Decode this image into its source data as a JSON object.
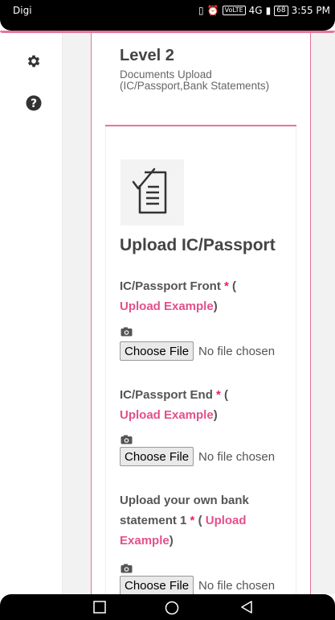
{
  "status_bar": {
    "carrier": "Digi",
    "network": "4G",
    "volte": "VoLTE",
    "battery": "68",
    "time": "3:55 PM"
  },
  "sidebar": {
    "items": [
      {
        "icon": "gear-icon"
      },
      {
        "icon": "help-icon"
      }
    ]
  },
  "level": {
    "title": "Level 2",
    "description": "Documents Upload (IC/Passport,Bank Statements)"
  },
  "upload": {
    "title": "Upload IC/Passport"
  },
  "fields": [
    {
      "label": "IC/Passport Front",
      "required": "*",
      "paren_open": "(",
      "link": "Upload Example",
      "paren_close": ")",
      "button": "Choose File",
      "status": "No file chosen"
    },
    {
      "label": "IC/Passport End",
      "required": "*",
      "paren_open": "(",
      "link": "Upload Example",
      "paren_close": ")",
      "button": "Choose File",
      "status": "No file chosen"
    },
    {
      "label": "Upload your own bank statement 1",
      "required": "*",
      "paren_open": "(",
      "link": "Upload Example",
      "paren_close": ")",
      "button": "Choose File",
      "status": "No file chosen"
    }
  ],
  "colors": {
    "accent": "#e6749e",
    "link": "#e3508a",
    "required": "#e5245e"
  }
}
